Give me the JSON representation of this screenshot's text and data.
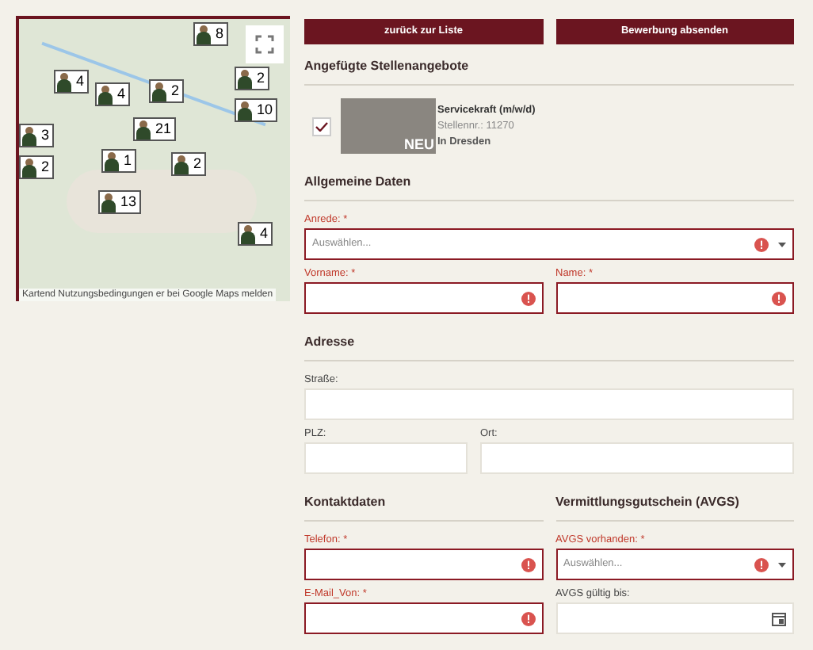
{
  "map": {
    "attribution": "Kartend Nutzungsbedingungen  er bei Google Maps melden",
    "markers": [
      {
        "count": "8"
      },
      {
        "count": "4"
      },
      {
        "count": "4"
      },
      {
        "count": "2"
      },
      {
        "count": "2"
      },
      {
        "count": "10"
      },
      {
        "count": "3"
      },
      {
        "count": "2"
      },
      {
        "count": "21"
      },
      {
        "count": "1"
      },
      {
        "count": "2"
      },
      {
        "count": "13"
      },
      {
        "count": "4"
      }
    ]
  },
  "buttons": [
    {
      "label": "zurück zur Liste"
    },
    {
      "label": "Bewerbung absenden"
    }
  ],
  "attached_jobs": {
    "heading": "Angefügte Stellenangebote",
    "jobs": [
      {
        "checked": true,
        "badge": "NEU",
        "title": "Servicekraft (m/w/d)",
        "number": "Stellennr.: 11270",
        "location": "In Dresden"
      }
    ]
  },
  "sections": [
    {
      "heading": "Allgemeine Daten",
      "rows": [
        [
          {
            "label": "Anrede: *",
            "kind": "select",
            "placeholder": "Auswählen...",
            "required": true
          }
        ],
        [
          {
            "label": "Vorname: *",
            "kind": "text",
            "required": true
          },
          {
            "label": "Name: *",
            "kind": "text",
            "required": true
          }
        ]
      ]
    },
    {
      "heading": "Adresse",
      "rows": [
        [
          {
            "label": "Straße:",
            "kind": "text",
            "required": false
          }
        ],
        [
          {
            "label": "PLZ:",
            "kind": "text",
            "required": false
          },
          {
            "label": "Ort:",
            "kind": "text",
            "required": false
          }
        ]
      ]
    }
  ],
  "columns": [
    {
      "heading": "Kontaktdaten",
      "fields": [
        {
          "label": "Telefon: *",
          "kind": "text",
          "required": true
        },
        {
          "label": "E-Mail_Von: *",
          "kind": "text",
          "required": true
        }
      ]
    },
    {
      "heading": "Vermittlungsgutschein (AVGS)",
      "fields": [
        {
          "label": "AVGS vorhanden: *",
          "kind": "select",
          "placeholder": "Auswählen...",
          "required": true
        },
        {
          "label": "AVGS gültig bis:",
          "kind": "date",
          "required": false
        }
      ]
    }
  ]
}
